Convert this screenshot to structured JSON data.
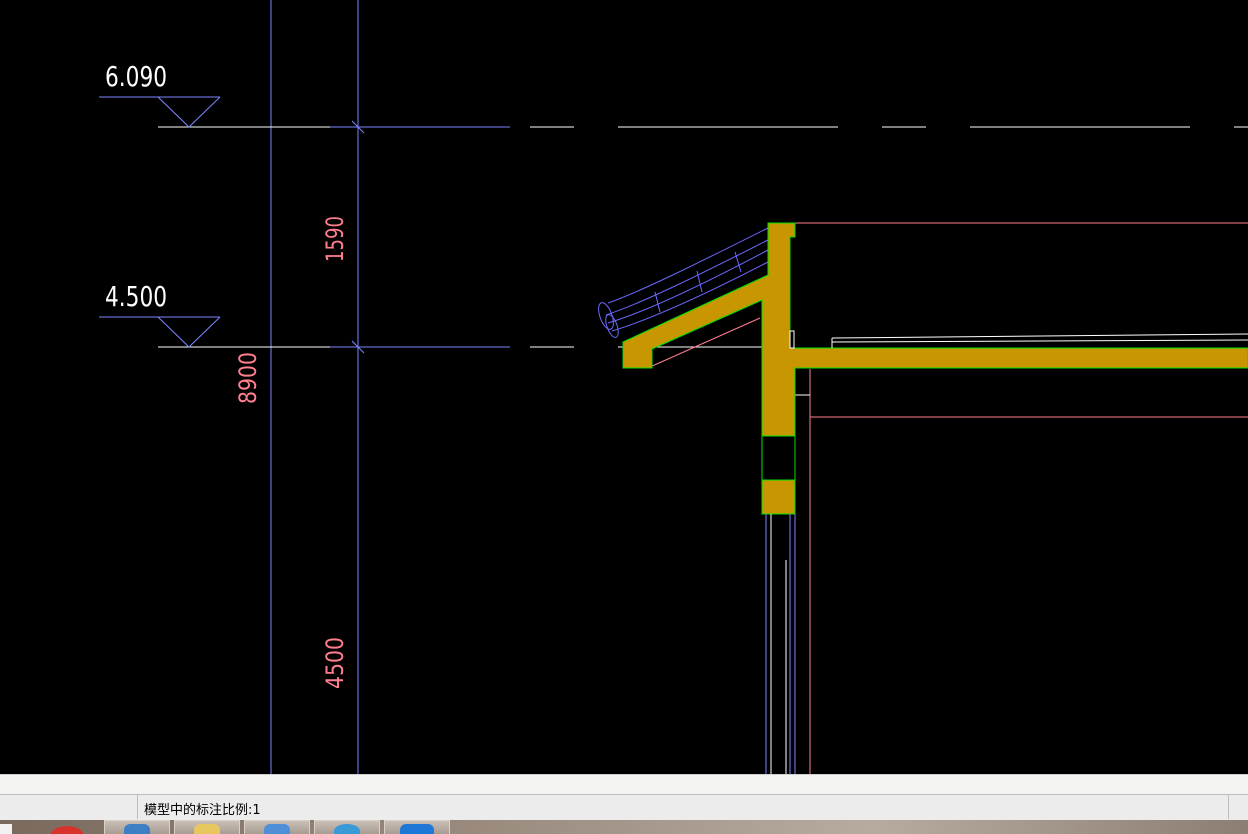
{
  "drawing": {
    "elevation_top": "6.090",
    "elevation_mid": "4.500",
    "dim_1590": "1590",
    "dim_8900": "8900",
    "dim_4500": "4500",
    "colors": {
      "background": "#000000",
      "axis_line": "#7b86ff",
      "dim_text": "#ff7f8f",
      "level_line": "#ffffff",
      "roof_fill": "#c89600",
      "roof_outline": "#00e000",
      "tile": "#6a6aff",
      "pink_line": "#ff7f8f"
    }
  },
  "status": {
    "scale_text": "模型中的标注比例:1"
  },
  "taskbar": {
    "items": [
      {
        "icon": "app-red-circle-icon"
      },
      {
        "icon": "computer-icon"
      },
      {
        "icon": "folder-icon"
      },
      {
        "icon": "mail-icon"
      },
      {
        "icon": "browser-icon"
      },
      {
        "icon": "download-icon"
      }
    ]
  }
}
